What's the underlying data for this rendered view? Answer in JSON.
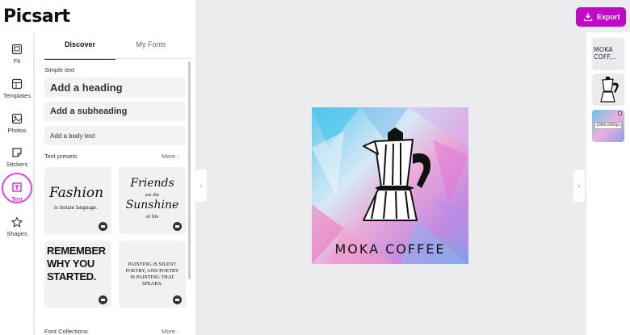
{
  "app": {
    "logo": "Picsart"
  },
  "rail": {
    "items": [
      {
        "label": "Fit",
        "icon": "fit-icon"
      },
      {
        "label": "Templates",
        "icon": "templates-icon"
      },
      {
        "label": "Photos",
        "icon": "photos-icon"
      },
      {
        "label": "Stickers",
        "icon": "stickers-icon"
      },
      {
        "label": "Text",
        "icon": "text-icon",
        "active": true
      },
      {
        "label": "Shapes",
        "icon": "shapes-icon"
      }
    ]
  },
  "panel": {
    "tabs": [
      {
        "label": "Discover",
        "selected": true
      },
      {
        "label": "My Fonts",
        "selected": false
      }
    ],
    "simple_text": {
      "title": "Simple text",
      "heading": "Add a heading",
      "subheading": "Add a subheading",
      "body": "Add a body text"
    },
    "presets": {
      "title": "Text presets",
      "more": "More",
      "cards": [
        {
          "line1": "Fashion",
          "line2": "is instant language."
        },
        {
          "line1": "Friends",
          "line2": "are the",
          "line3": "Sunshine",
          "line4": "of life"
        },
        {
          "line1": "REMEMBER",
          "line2": "WHY YOU",
          "line3": "STARTED."
        },
        {
          "line1": "PAINTING IS SILENT",
          "line2": "POETRY, AND POETRY",
          "line3": "IS PAINTING THAT",
          "line4": "SPEAKS."
        }
      ]
    },
    "collections": {
      "title": "Font Collections",
      "more": "More"
    }
  },
  "canvas": {
    "art_title": "MOKA COFFEE"
  },
  "toolbar": {
    "export_label": "Export"
  },
  "layers": {
    "text_thumb": "MOKA COFF...",
    "size_label": "1080x1080px"
  },
  "colors": {
    "accent": "#c009c4",
    "ring": "#ee3fe6"
  }
}
